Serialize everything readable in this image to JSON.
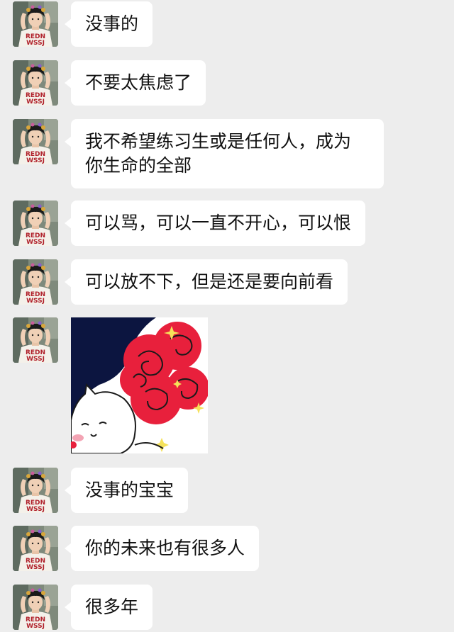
{
  "messages": [
    {
      "kind": "text",
      "text": "没事的"
    },
    {
      "kind": "text",
      "text": "不要太焦虑了"
    },
    {
      "kind": "text",
      "line1": "我不希望练习生或是任何人，成为",
      "line2": "你生命的全部"
    },
    {
      "kind": "text",
      "text": "可以骂，可以一直不开心，可以恨"
    },
    {
      "kind": "text",
      "text": "可以放不下，但是还是要向前看"
    },
    {
      "kind": "sticker",
      "description_icon": "cat-with-roses-sticker-icon"
    },
    {
      "kind": "text",
      "text": "没事的宝宝"
    },
    {
      "kind": "text",
      "text": "你的未来也有很多人"
    },
    {
      "kind": "text",
      "text": "很多年"
    }
  ],
  "avatar": {
    "icon": "user-avatar-icon"
  },
  "colors": {
    "background": "#ededed",
    "bubble": "#ffffff",
    "text": "#111111",
    "rose": "#e8203c",
    "sticker_night": "#0c1540",
    "shirt_print": "#b0202a"
  }
}
